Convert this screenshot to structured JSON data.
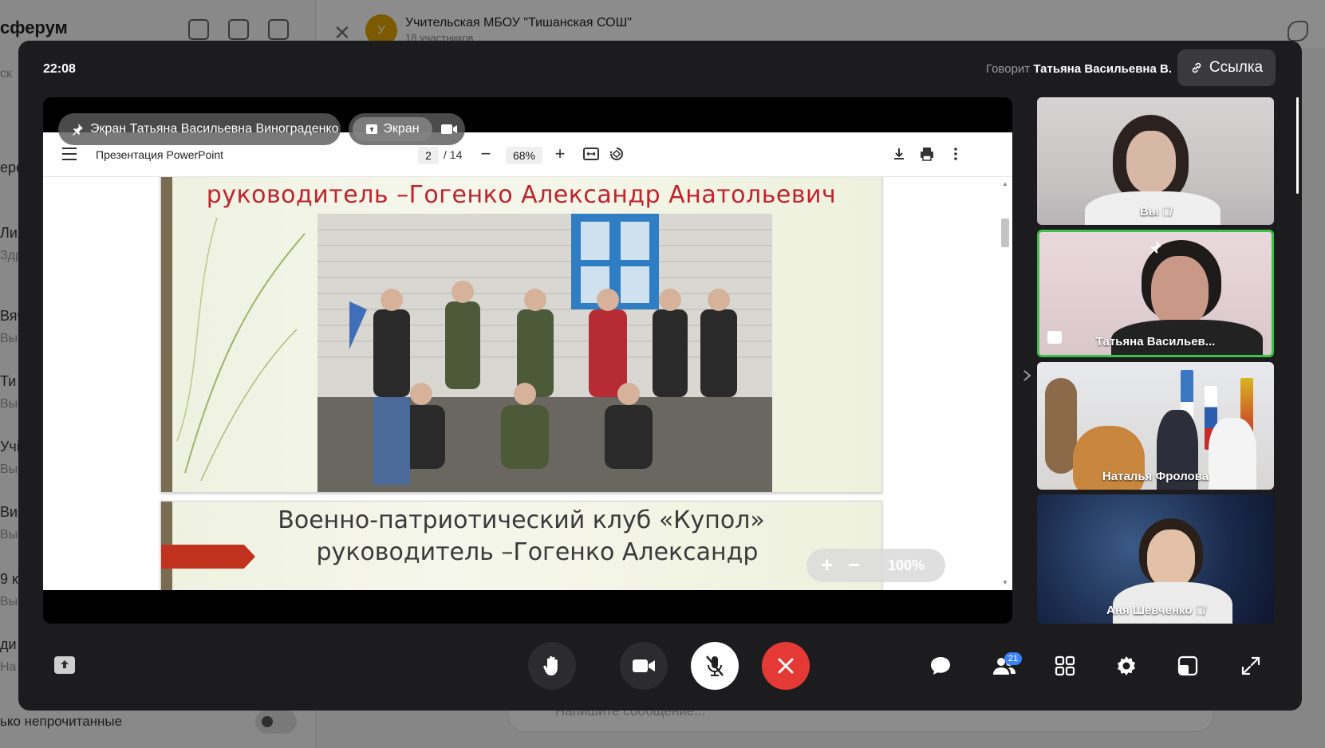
{
  "background": {
    "brand": "сферум",
    "chat_title": "Учительская МБОУ \"Тишанская СОШ\"",
    "chat_members": "18 участников",
    "avatar_letter": "У",
    "sidebar_fragments": [
      "ск",
      "ере",
      "Ли",
      "Здр",
      "Вяч",
      "Вы",
      "Ти",
      "Вы",
      "Учі",
      "Вы",
      "Ви",
      "Вы",
      "9 к",
      "Вы",
      "ди",
      "На"
    ],
    "unread_label": "ько непрочитанные",
    "composer_placeholder": "Напишите сообщение..."
  },
  "call": {
    "time": "22:08",
    "speaking_prefix": "Говорит",
    "speaker": "Татьяна Васильевна В.",
    "link_button": "Ссылка"
  },
  "screen_share": {
    "owner_label": "Экран Татьяна Васильевна Винограденко",
    "tab_screen": "Экран",
    "tab_camera_icon": "camera-icon",
    "zoom_value": "100%"
  },
  "viewer": {
    "doc_title": "Презентация PowerPoint",
    "page_current": "2",
    "page_total": "/ 14",
    "zoom": "68%"
  },
  "slides": {
    "slide1_caption": "руководитель –Гогенко Александр Анатольевич",
    "slide2_line1": "Военно-патриотический клуб «Купол»",
    "slide2_line2": "руководитель –Гогенко Александр"
  },
  "participants": [
    {
      "name": "Вы",
      "muted": true
    },
    {
      "name": "Татьяна Васильев...",
      "pinned": true,
      "sharing": true,
      "speaking": true
    },
    {
      "name": "Наталья Фролова"
    },
    {
      "name": "Аня Шевченко",
      "muted": true
    }
  ],
  "controls": {
    "participants_count": "21"
  },
  "colors": {
    "call_bg": "#1c1c1e",
    "end_call": "#e53935",
    "speaking_border": "#3cc04a",
    "badge": "#3b82f6",
    "slide_red": "#c0232e"
  }
}
